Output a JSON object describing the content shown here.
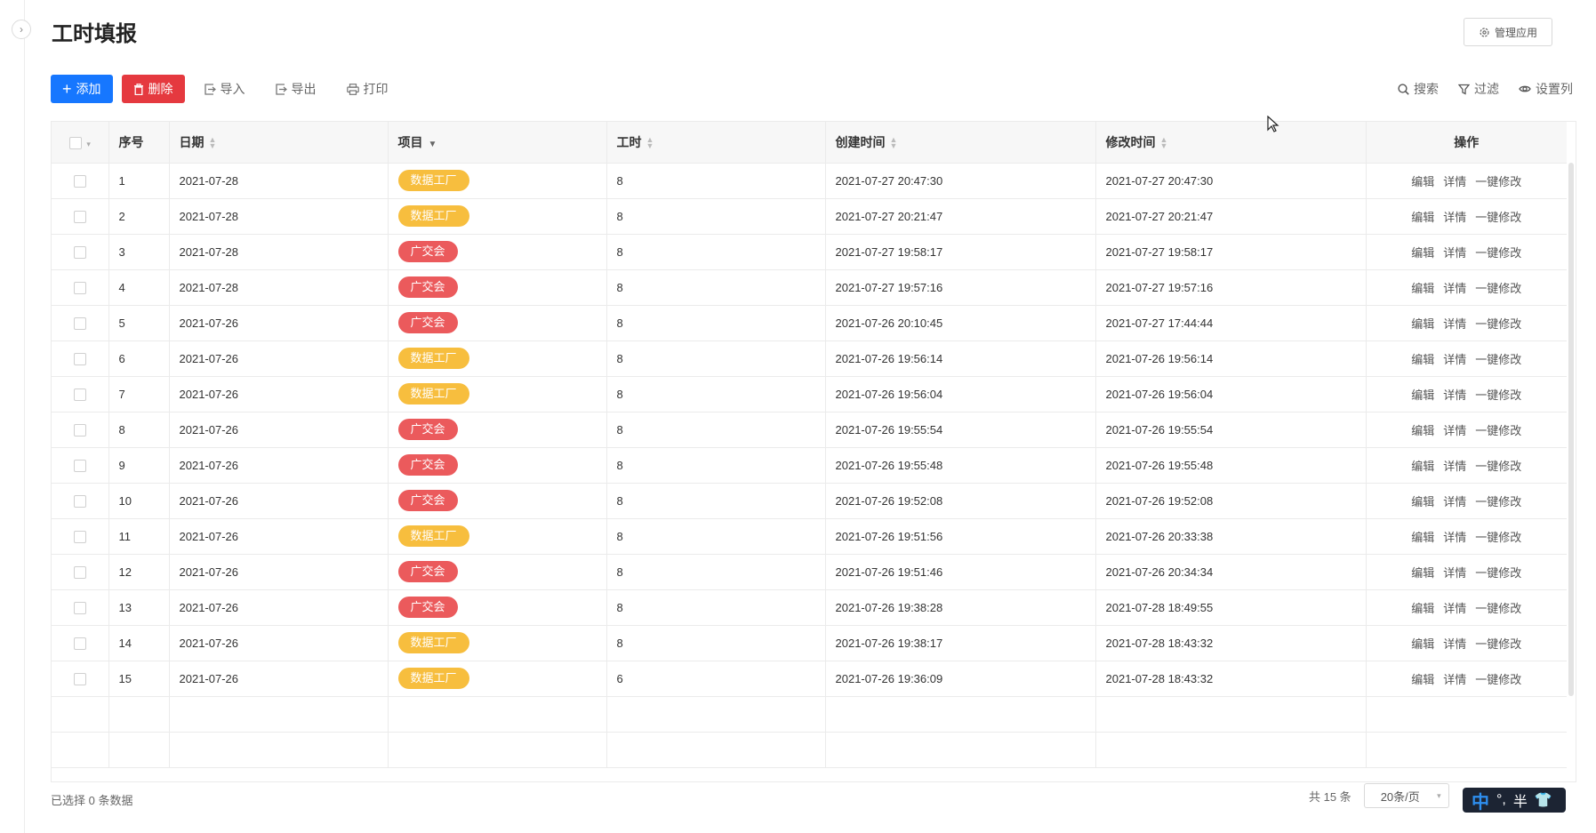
{
  "page": {
    "title": "工时填报"
  },
  "header": {
    "manage_label": "管理应用"
  },
  "toolbar": {
    "add_label": "添加",
    "delete_label": "删除",
    "import_label": "导入",
    "export_label": "导出",
    "print_label": "打印"
  },
  "right_tools": {
    "search_label": "搜索",
    "filter_label": "过滤",
    "columns_label": "设置列"
  },
  "table": {
    "columns": {
      "index": "序号",
      "date": "日期",
      "project": "项目",
      "hours": "工时",
      "created": "创建时间",
      "modified": "修改时间",
      "actions": "操作"
    },
    "actions": {
      "edit": "编辑",
      "detail": "详情",
      "quick_edit": "一键修改"
    },
    "rows": [
      {
        "index": "1",
        "date": "2021-07-28",
        "project": "数据工厂",
        "hours": "8",
        "created": "2021-07-27 20:47:30",
        "modified": "2021-07-27 20:47:30"
      },
      {
        "index": "2",
        "date": "2021-07-28",
        "project": "数据工厂",
        "hours": "8",
        "created": "2021-07-27 20:21:47",
        "modified": "2021-07-27 20:21:47"
      },
      {
        "index": "3",
        "date": "2021-07-28",
        "project": "广交会",
        "hours": "8",
        "created": "2021-07-27 19:58:17",
        "modified": "2021-07-27 19:58:17"
      },
      {
        "index": "4",
        "date": "2021-07-28",
        "project": "广交会",
        "hours": "8",
        "created": "2021-07-27 19:57:16",
        "modified": "2021-07-27 19:57:16"
      },
      {
        "index": "5",
        "date": "2021-07-26",
        "project": "广交会",
        "hours": "8",
        "created": "2021-07-26 20:10:45",
        "modified": "2021-07-27 17:44:44"
      },
      {
        "index": "6",
        "date": "2021-07-26",
        "project": "数据工厂",
        "hours": "8",
        "created": "2021-07-26 19:56:14",
        "modified": "2021-07-26 19:56:14"
      },
      {
        "index": "7",
        "date": "2021-07-26",
        "project": "数据工厂",
        "hours": "8",
        "created": "2021-07-26 19:56:04",
        "modified": "2021-07-26 19:56:04"
      },
      {
        "index": "8",
        "date": "2021-07-26",
        "project": "广交会",
        "hours": "8",
        "created": "2021-07-26 19:55:54",
        "modified": "2021-07-26 19:55:54"
      },
      {
        "index": "9",
        "date": "2021-07-26",
        "project": "广交会",
        "hours": "8",
        "created": "2021-07-26 19:55:48",
        "modified": "2021-07-26 19:55:48"
      },
      {
        "index": "10",
        "date": "2021-07-26",
        "project": "广交会",
        "hours": "8",
        "created": "2021-07-26 19:52:08",
        "modified": "2021-07-26 19:52:08"
      },
      {
        "index": "11",
        "date": "2021-07-26",
        "project": "数据工厂",
        "hours": "8",
        "created": "2021-07-26 19:51:56",
        "modified": "2021-07-26 20:33:38"
      },
      {
        "index": "12",
        "date": "2021-07-26",
        "project": "广交会",
        "hours": "8",
        "created": "2021-07-26 19:51:46",
        "modified": "2021-07-26 20:34:34"
      },
      {
        "index": "13",
        "date": "2021-07-26",
        "project": "广交会",
        "hours": "8",
        "created": "2021-07-26 19:38:28",
        "modified": "2021-07-28 18:49:55"
      },
      {
        "index": "14",
        "date": "2021-07-26",
        "project": "数据工厂",
        "hours": "8",
        "created": "2021-07-26 19:38:17",
        "modified": "2021-07-28 18:43:32"
      },
      {
        "index": "15",
        "date": "2021-07-26",
        "project": "数据工厂",
        "hours": "6",
        "created": "2021-07-26 19:36:09",
        "modified": "2021-07-28 18:43:32"
      }
    ]
  },
  "tag_colors": {
    "数据工厂": "#f7be3e",
    "广交会": "#eb5a5c"
  },
  "footer": {
    "selected_text": "已选择 0 条数据",
    "total_text": "共 15 条",
    "page_size": "20条/页"
  },
  "ime": {
    "mode": "中",
    "punct": "°,",
    "width": "半"
  },
  "colors": {
    "primary": "#1677ff",
    "danger": "#e5393f"
  }
}
